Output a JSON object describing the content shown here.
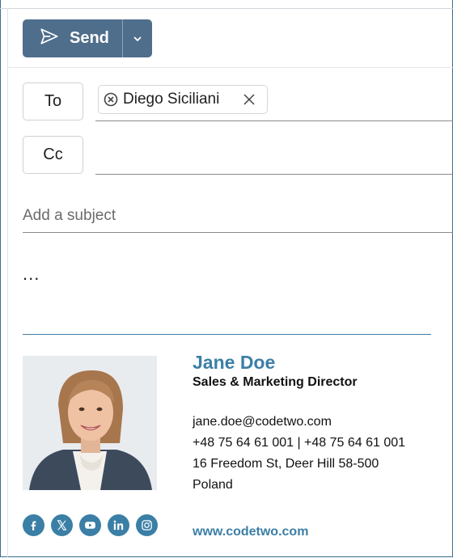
{
  "toolbar": {
    "send_label": "Send"
  },
  "recipients": {
    "to_label": "To",
    "cc_label": "Cc",
    "to_list": [
      {
        "name": "Diego Siciliani"
      }
    ]
  },
  "subject": {
    "placeholder": "Add a subject",
    "value": ""
  },
  "body": {
    "text": "..."
  },
  "signature": {
    "name": "Jane Doe",
    "title": "Sales & Marketing Director",
    "email": "jane.doe@codetwo.com",
    "phone": "+48 75 64 61 001 | +48 75 64 61 001",
    "address": "16 Freedom St, Deer Hill 58-500",
    "country": "Poland",
    "website": "www.codetwo.com",
    "accent_color": "#3b7fa6",
    "socials": [
      "facebook-icon",
      "x-icon",
      "youtube-icon",
      "linkedin-icon",
      "instagram-icon"
    ]
  },
  "colors": {
    "send_button": "#4f6e8b",
    "accent": "#3b7fa6"
  }
}
